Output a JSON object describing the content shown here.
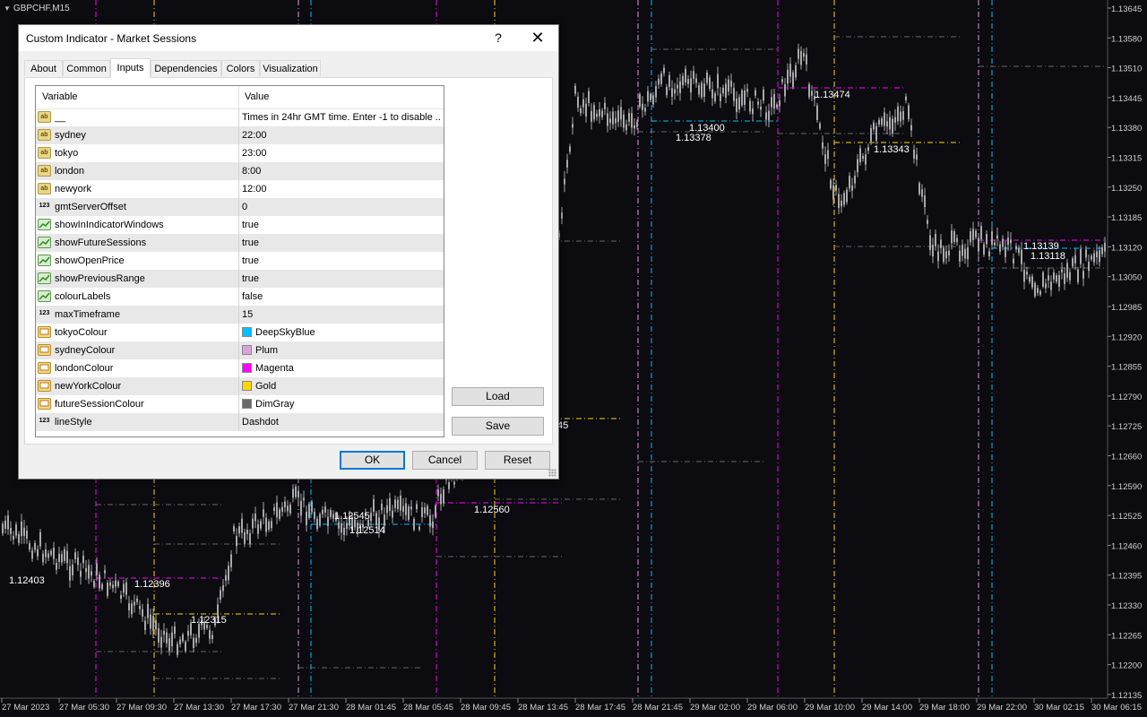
{
  "chart": {
    "symbol": "GBPCHF,M15",
    "price_scale": [
      "1.13645",
      "1.13580",
      "1.13510",
      "1.13445",
      "1.13380",
      "1.13315",
      "1.13250",
      "1.13185",
      "1.13120",
      "1.13050",
      "1.12985",
      "1.12920",
      "1.12855",
      "1.12790",
      "1.12725",
      "1.12660",
      "1.12590",
      "1.12525",
      "1.12460",
      "1.12395",
      "1.12330",
      "1.12265",
      "1.12200",
      "1.12135"
    ],
    "time_axis": [
      "27 Mar 2023",
      "27 Mar 05:30",
      "27 Mar 09:30",
      "27 Mar 13:30",
      "27 Mar 17:30",
      "27 Mar 21:30",
      "28 Mar 01:45",
      "28 Mar 05:45",
      "28 Mar 09:45",
      "28 Mar 13:45",
      "28 Mar 17:45",
      "28 Mar 21:45",
      "29 Mar 02:00",
      "29 Mar 06:00",
      "29 Mar 10:00",
      "29 Mar 14:00",
      "29 Mar 18:00",
      "29 Mar 22:00",
      "30 Mar 02:15",
      "30 Mar 06:15"
    ],
    "session_labels": [
      "1.12403",
      "1.12396",
      "1.12315",
      "1.12545",
      "1.12514",
      "1.12560",
      "1.13400",
      "1.13378",
      "1.13474",
      "1.13343",
      "1.13139",
      "1.13118",
      "45"
    ],
    "colors": {
      "background": "#0b0b10",
      "candles": "#a9a9a9",
      "tokyo": "#00bfff",
      "sydney": "#dda0dd",
      "london": "#ff00ff",
      "newyork": "#ffd700",
      "future": "#696969"
    }
  },
  "dialog": {
    "title": "Custom Indicator - Market Sessions",
    "help_glyph": "?",
    "close_glyph": "✕",
    "tabs": [
      {
        "label": "About"
      },
      {
        "label": "Common"
      },
      {
        "label": "Inputs"
      },
      {
        "label": "Dependencies"
      },
      {
        "label": "Colors"
      },
      {
        "label": "Visualization"
      }
    ],
    "active_tab": "Inputs",
    "grid": {
      "col_variable": "Variable",
      "col_value": "Value",
      "rows": [
        {
          "variable": "__",
          "value": "Times in 24hr GMT time. Enter -1 to disable ...",
          "icon": "text"
        },
        {
          "variable": "sydney",
          "value": "22:00",
          "icon": "text"
        },
        {
          "variable": "tokyo",
          "value": "23:00",
          "icon": "text"
        },
        {
          "variable": "london",
          "value": "8:00",
          "icon": "text"
        },
        {
          "variable": "newyork",
          "value": "12:00",
          "icon": "text"
        },
        {
          "variable": "gmtServerOffset",
          "value": "0",
          "icon": "number"
        },
        {
          "variable": "showInIndicatorWindows",
          "value": "true",
          "icon": "bool"
        },
        {
          "variable": "showFutureSessions",
          "value": "true",
          "icon": "bool"
        },
        {
          "variable": "showOpenPrice",
          "value": "true",
          "icon": "bool"
        },
        {
          "variable": "showPreviousRange",
          "value": "true",
          "icon": "bool"
        },
        {
          "variable": "colourLabels",
          "value": "false",
          "icon": "bool"
        },
        {
          "variable": "maxTimeframe",
          "value": "15",
          "icon": "number"
        },
        {
          "variable": "tokyoColour",
          "value": "DeepSkyBlue",
          "icon": "color",
          "swatch": "#00bfff"
        },
        {
          "variable": "sydneyColour",
          "value": "Plum",
          "icon": "color",
          "swatch": "#dda0dd"
        },
        {
          "variable": "londonColour",
          "value": "Magenta",
          "icon": "color",
          "swatch": "#ff00ff"
        },
        {
          "variable": "newYorkColour",
          "value": "Gold",
          "icon": "color",
          "swatch": "#ffd700"
        },
        {
          "variable": "futureSessionColour",
          "value": "DimGray",
          "icon": "color",
          "swatch": "#696969"
        },
        {
          "variable": "lineStyle",
          "value": "Dashdot",
          "icon": "number"
        }
      ]
    },
    "buttons": {
      "load": "Load",
      "save": "Save",
      "ok": "OK",
      "cancel": "Cancel",
      "reset": "Reset"
    }
  }
}
